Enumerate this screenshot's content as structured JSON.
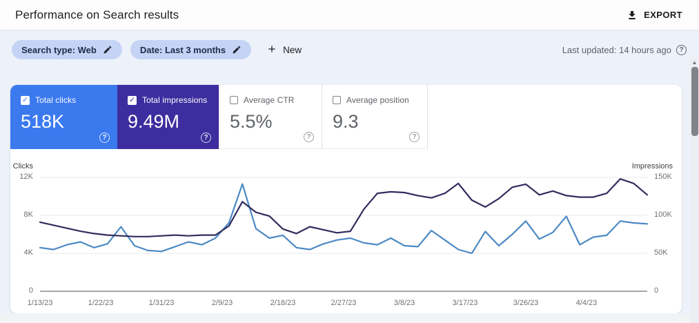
{
  "header": {
    "title": "Performance on Search results",
    "export_label": "EXPORT"
  },
  "filters": {
    "chips": [
      {
        "label": "Search type: Web"
      },
      {
        "label": "Date: Last 3 months"
      }
    ],
    "new_label": "New",
    "last_updated": "Last updated: 14 hours ago",
    "help_glyph": "?"
  },
  "metrics": [
    {
      "label": "Total clicks",
      "value": "518K",
      "checked": true,
      "color": "#3b79ef",
      "help_glyph": "?"
    },
    {
      "label": "Total impressions",
      "value": "9.49M",
      "checked": true,
      "color": "#3d2d9e",
      "help_glyph": "?"
    },
    {
      "label": "Average CTR",
      "value": "5.5%",
      "checked": false,
      "color": "#ffffff",
      "help_glyph": "?"
    },
    {
      "label": "Average position",
      "value": "9.3",
      "checked": false,
      "color": "#ffffff",
      "help_glyph": "?"
    }
  ],
  "chart_data": {
    "type": "line",
    "grid": true,
    "x_range_days": [
      0,
      90
    ],
    "point_interval_days": 2,
    "x_tick_labels": [
      "1/13/23",
      "1/22/23",
      "1/31/23",
      "2/9/23",
      "2/18/23",
      "2/27/23",
      "3/8/23",
      "3/17/23",
      "3/26/23",
      "4/4/23"
    ],
    "x_tick_positions_days": [
      0,
      9,
      18,
      27,
      36,
      45,
      54,
      63,
      72,
      81
    ],
    "left_axis": {
      "label": "Clicks",
      "ticks": [
        "12K",
        "8K",
        "4K",
        "0"
      ],
      "max_k": 12
    },
    "right_axis": {
      "label": "Impressions",
      "ticks": [
        "150K",
        "100K",
        "50K",
        "0"
      ],
      "max_k": 150
    },
    "series": [
      {
        "name": "Total clicks",
        "axis": "left",
        "axis_max_k": 12,
        "color": "#4b89c4",
        "unit": "thousands of clicks",
        "values": [
          4.6,
          4.4,
          4.9,
          5.2,
          4.6,
          5.0,
          6.8,
          4.8,
          4.3,
          4.2,
          4.7,
          5.2,
          4.9,
          5.6,
          7.2,
          11.3,
          6.6,
          5.6,
          5.9,
          4.6,
          4.4,
          5.0,
          5.4,
          5.6,
          5.1,
          4.9,
          5.6,
          4.8,
          4.7,
          6.4,
          5.4,
          4.4,
          4.0,
          6.3,
          4.8,
          6.0,
          7.4,
          5.5,
          6.2,
          7.9,
          4.9,
          5.7,
          5.9,
          7.4,
          7.2,
          7.1
        ]
      },
      {
        "name": "Total impressions",
        "axis": "right",
        "axis_max_k": 150,
        "color": "#322b5d",
        "unit": "thousands of impressions",
        "values": [
          91,
          87,
          83,
          79,
          76,
          74,
          73,
          72,
          72,
          73,
          74,
          73,
          74,
          74,
          86,
          118,
          104,
          99,
          82,
          76,
          85,
          81,
          77,
          79,
          108,
          129,
          131,
          130,
          126,
          123,
          129,
          142,
          120,
          111,
          122,
          137,
          141,
          127,
          132,
          126,
          124,
          124,
          129,
          148,
          142,
          127
        ]
      }
    ]
  }
}
